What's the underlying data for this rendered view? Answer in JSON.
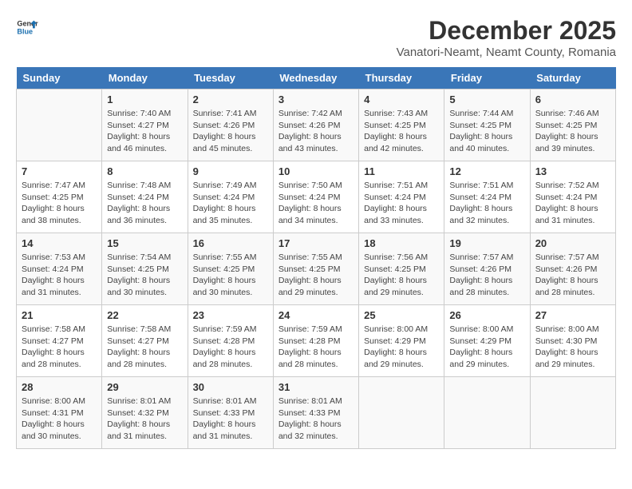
{
  "header": {
    "logo_line1": "General",
    "logo_line2": "Blue",
    "month": "December 2025",
    "location": "Vanatori-Neamt, Neamt County, Romania"
  },
  "days_of_week": [
    "Sunday",
    "Monday",
    "Tuesday",
    "Wednesday",
    "Thursday",
    "Friday",
    "Saturday"
  ],
  "weeks": [
    [
      {
        "day": "",
        "info": ""
      },
      {
        "day": "1",
        "info": "Sunrise: 7:40 AM\nSunset: 4:27 PM\nDaylight: 8 hours\nand 46 minutes."
      },
      {
        "day": "2",
        "info": "Sunrise: 7:41 AM\nSunset: 4:26 PM\nDaylight: 8 hours\nand 45 minutes."
      },
      {
        "day": "3",
        "info": "Sunrise: 7:42 AM\nSunset: 4:26 PM\nDaylight: 8 hours\nand 43 minutes."
      },
      {
        "day": "4",
        "info": "Sunrise: 7:43 AM\nSunset: 4:25 PM\nDaylight: 8 hours\nand 42 minutes."
      },
      {
        "day": "5",
        "info": "Sunrise: 7:44 AM\nSunset: 4:25 PM\nDaylight: 8 hours\nand 40 minutes."
      },
      {
        "day": "6",
        "info": "Sunrise: 7:46 AM\nSunset: 4:25 PM\nDaylight: 8 hours\nand 39 minutes."
      }
    ],
    [
      {
        "day": "7",
        "info": "Sunrise: 7:47 AM\nSunset: 4:25 PM\nDaylight: 8 hours\nand 38 minutes."
      },
      {
        "day": "8",
        "info": "Sunrise: 7:48 AM\nSunset: 4:24 PM\nDaylight: 8 hours\nand 36 minutes."
      },
      {
        "day": "9",
        "info": "Sunrise: 7:49 AM\nSunset: 4:24 PM\nDaylight: 8 hours\nand 35 minutes."
      },
      {
        "day": "10",
        "info": "Sunrise: 7:50 AM\nSunset: 4:24 PM\nDaylight: 8 hours\nand 34 minutes."
      },
      {
        "day": "11",
        "info": "Sunrise: 7:51 AM\nSunset: 4:24 PM\nDaylight: 8 hours\nand 33 minutes."
      },
      {
        "day": "12",
        "info": "Sunrise: 7:51 AM\nSunset: 4:24 PM\nDaylight: 8 hours\nand 32 minutes."
      },
      {
        "day": "13",
        "info": "Sunrise: 7:52 AM\nSunset: 4:24 PM\nDaylight: 8 hours\nand 31 minutes."
      }
    ],
    [
      {
        "day": "14",
        "info": "Sunrise: 7:53 AM\nSunset: 4:24 PM\nDaylight: 8 hours\nand 31 minutes."
      },
      {
        "day": "15",
        "info": "Sunrise: 7:54 AM\nSunset: 4:25 PM\nDaylight: 8 hours\nand 30 minutes."
      },
      {
        "day": "16",
        "info": "Sunrise: 7:55 AM\nSunset: 4:25 PM\nDaylight: 8 hours\nand 30 minutes."
      },
      {
        "day": "17",
        "info": "Sunrise: 7:55 AM\nSunset: 4:25 PM\nDaylight: 8 hours\nand 29 minutes."
      },
      {
        "day": "18",
        "info": "Sunrise: 7:56 AM\nSunset: 4:25 PM\nDaylight: 8 hours\nand 29 minutes."
      },
      {
        "day": "19",
        "info": "Sunrise: 7:57 AM\nSunset: 4:26 PM\nDaylight: 8 hours\nand 28 minutes."
      },
      {
        "day": "20",
        "info": "Sunrise: 7:57 AM\nSunset: 4:26 PM\nDaylight: 8 hours\nand 28 minutes."
      }
    ],
    [
      {
        "day": "21",
        "info": "Sunrise: 7:58 AM\nSunset: 4:27 PM\nDaylight: 8 hours\nand 28 minutes."
      },
      {
        "day": "22",
        "info": "Sunrise: 7:58 AM\nSunset: 4:27 PM\nDaylight: 8 hours\nand 28 minutes."
      },
      {
        "day": "23",
        "info": "Sunrise: 7:59 AM\nSunset: 4:28 PM\nDaylight: 8 hours\nand 28 minutes."
      },
      {
        "day": "24",
        "info": "Sunrise: 7:59 AM\nSunset: 4:28 PM\nDaylight: 8 hours\nand 28 minutes."
      },
      {
        "day": "25",
        "info": "Sunrise: 8:00 AM\nSunset: 4:29 PM\nDaylight: 8 hours\nand 29 minutes."
      },
      {
        "day": "26",
        "info": "Sunrise: 8:00 AM\nSunset: 4:29 PM\nDaylight: 8 hours\nand 29 minutes."
      },
      {
        "day": "27",
        "info": "Sunrise: 8:00 AM\nSunset: 4:30 PM\nDaylight: 8 hours\nand 29 minutes."
      }
    ],
    [
      {
        "day": "28",
        "info": "Sunrise: 8:00 AM\nSunset: 4:31 PM\nDaylight: 8 hours\nand 30 minutes."
      },
      {
        "day": "29",
        "info": "Sunrise: 8:01 AM\nSunset: 4:32 PM\nDaylight: 8 hours\nand 31 minutes."
      },
      {
        "day": "30",
        "info": "Sunrise: 8:01 AM\nSunset: 4:33 PM\nDaylight: 8 hours\nand 31 minutes."
      },
      {
        "day": "31",
        "info": "Sunrise: 8:01 AM\nSunset: 4:33 PM\nDaylight: 8 hours\nand 32 minutes."
      },
      {
        "day": "",
        "info": ""
      },
      {
        "day": "",
        "info": ""
      },
      {
        "day": "",
        "info": ""
      }
    ]
  ]
}
